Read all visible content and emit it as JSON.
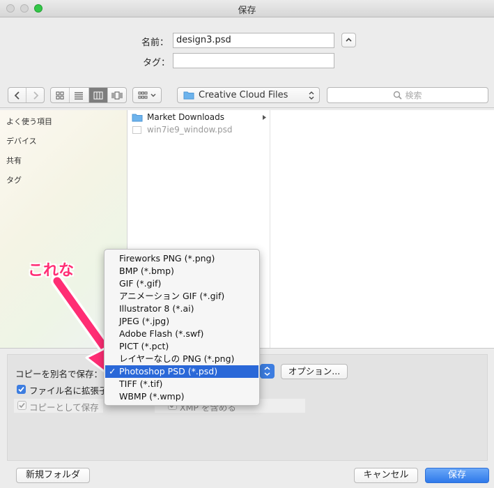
{
  "window": {
    "title": "保存"
  },
  "form": {
    "name_label": "名前：",
    "name_value": "design3.psd",
    "tag_label": "タグ：",
    "tag_value": ""
  },
  "toolbar": {
    "location": "Creative Cloud Files",
    "search_placeholder": "検索"
  },
  "sidebar": {
    "items": [
      {
        "label": "よく使う項目"
      },
      {
        "label": "デバイス"
      },
      {
        "label": "共有"
      },
      {
        "label": "タグ"
      }
    ]
  },
  "files": [
    {
      "name": "Market Downloads",
      "kind": "folder"
    },
    {
      "name": "win7ie9_window.psd",
      "kind": "file"
    }
  ],
  "options": {
    "copy_label": "コピーを別名で保存：",
    "options_button": "オプション...",
    "extension_label": "ファイル名に拡張子",
    "extension_checked": true,
    "save_as_copy_label": "コピーとして保存",
    "save_as_copy_checked": true,
    "xmp_label": "XMP を含める"
  },
  "format_menu": {
    "items": [
      "Fireworks PNG (*.png)",
      "BMP (*.bmp)",
      "GIF (*.gif)",
      "アニメーション GIF (*.gif)",
      "Illustrator 8 (*.ai)",
      "JPEG (*.jpg)",
      "Adobe Flash (*.swf)",
      "PICT (*.pct)",
      "レイヤーなしの PNG (*.png)",
      "Photoshop PSD (*.psd)",
      "TIFF (*.tif)",
      "WBMP (*.wmp)"
    ],
    "selected_index": 9,
    "checkmark": "✓"
  },
  "buttons": {
    "new_folder": "新規フォルダ",
    "cancel": "キャンセル",
    "save": "保存"
  },
  "annotation": {
    "text": "これな"
  },
  "colors": {
    "accent": "#2a68d8",
    "annotation": "#ff2d74"
  }
}
